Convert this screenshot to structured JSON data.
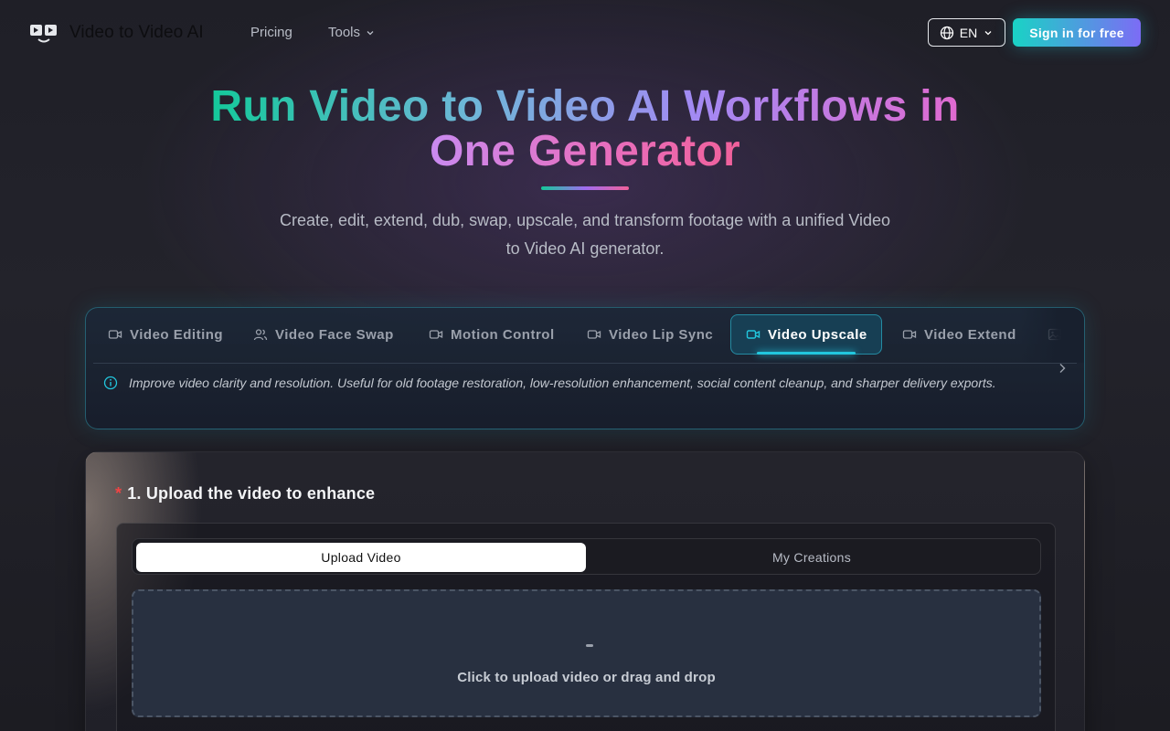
{
  "header": {
    "logo_text": "Video to Video AI",
    "nav": {
      "pricing": "Pricing",
      "tools": "Tools"
    },
    "language": "EN",
    "signin_label": "Sign in for free"
  },
  "hero": {
    "title_line1": "Run Video to Video AI Workflows in",
    "title_line2": "One Generator",
    "subtitle": "Create, edit, extend, dub, swap, upscale, and transform footage with a unified Video to Video AI generator."
  },
  "tabs": {
    "items": [
      {
        "label": "Video Editing",
        "icon": "video-camera-icon"
      },
      {
        "label": "Video Face Swap",
        "icon": "users-icon"
      },
      {
        "label": "Motion Control",
        "icon": "video-camera-icon"
      },
      {
        "label": "Video Lip Sync",
        "icon": "video-camera-icon"
      },
      {
        "label": "Video Upscale",
        "icon": "video-camera-icon",
        "active": true
      },
      {
        "label": "Video Extend",
        "icon": "video-camera-icon"
      },
      {
        "label": "",
        "icon": "image-icon"
      }
    ],
    "description": "Improve video clarity and resolution. Useful for old footage restoration, low-resolution enhancement, social content cleanup, and sharper delivery exports."
  },
  "upload": {
    "step_title": "1. Upload the video to enhance",
    "required_mark": "*",
    "segments": {
      "upload": "Upload Video",
      "creations": "My Creations"
    },
    "dropzone_text": "Click to upload video or drag and drop"
  },
  "colors": {
    "accent_teal": "#22c7de",
    "accent_purple": "#7c6cf5",
    "required_red": "#ef4444"
  }
}
